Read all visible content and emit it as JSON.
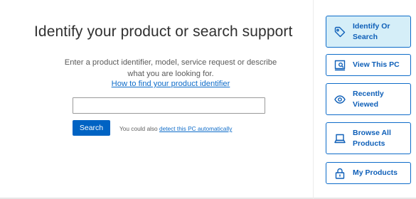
{
  "main": {
    "title": "Identify your product or search support",
    "description": "Enter a product identifier, model, service request or describe what you are looking for.",
    "howto_link": "How to find your product identifier",
    "search_input": {
      "value": "",
      "placeholder": ""
    },
    "search_button": "Search",
    "detect_prefix": "You could also",
    "detect_link": "detect this PC automatically"
  },
  "sidebar": {
    "accent_color": "#0e6cc9",
    "active_bg": "#d5eef8",
    "items": [
      {
        "label": "Identify Or Search",
        "icon": "tag-icon",
        "active": true
      },
      {
        "label": "View This PC",
        "icon": "pc-search-icon",
        "active": false
      },
      {
        "label": "Recently Viewed",
        "icon": "eye-icon",
        "active": false
      },
      {
        "label": "Browse All Products",
        "icon": "laptop-icon",
        "active": false
      },
      {
        "label": "My Products",
        "icon": "lock-icon",
        "active": false
      }
    ]
  }
}
